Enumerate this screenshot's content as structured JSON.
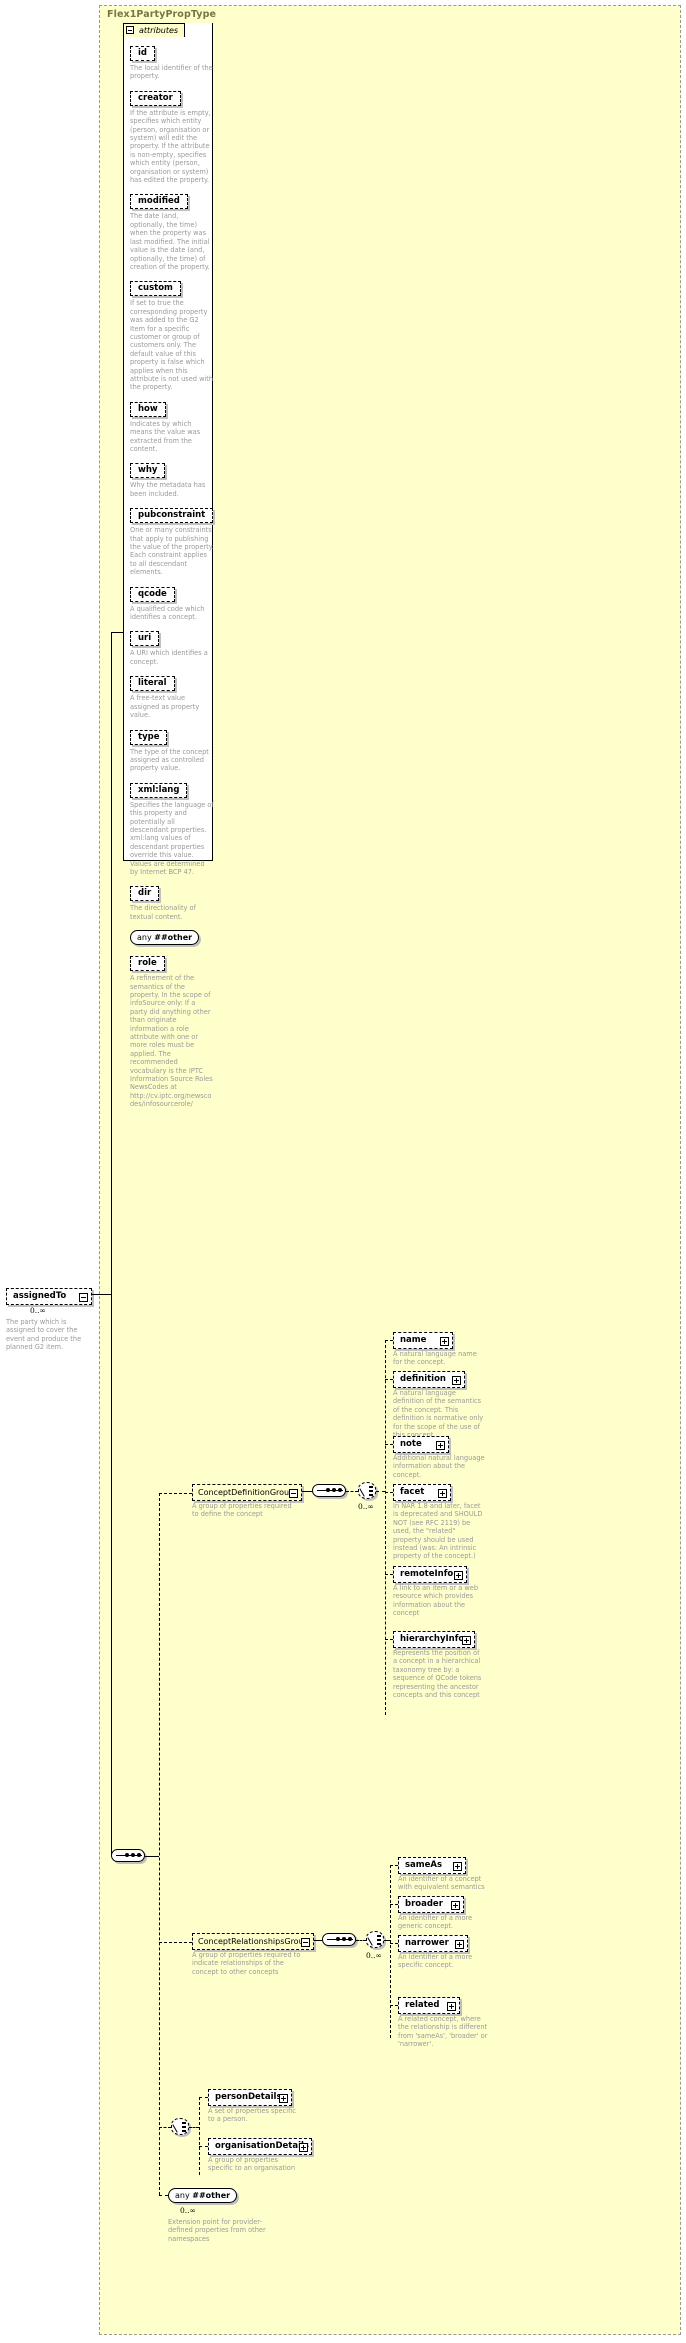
{
  "diagram": {
    "type_name": "Flex1PartyPropType",
    "attributes_label": "attributes",
    "colors": {
      "type_fill": "#ffffcc",
      "desc_text": "#9a9a9a",
      "title_text": "#777744",
      "box_fill": "#ffffff"
    }
  },
  "attributes": [
    {
      "name": "id",
      "desc": "The local identifier of the property."
    },
    {
      "name": "creator",
      "desc": "If the attribute is empty, specifies which entity (person, organisation or system) will edit the property. If the attribute is non-empty, specifies which entity (person, organisation or system) has edited the property."
    },
    {
      "name": "modified",
      "desc": "The date (and, optionally, the time) when the property was last modified. The initial value is the date (and, optionally, the time) of creation of the property."
    },
    {
      "name": "custom",
      "desc": "If set to true the corresponding property was added to the G2 Item for a specific customer or group of customers only. The default value of this property is false which applies when this attribute is not used with the property."
    },
    {
      "name": "how",
      "desc": "Indicates by which means the value was extracted from the content."
    },
    {
      "name": "why",
      "desc": "Why the metadata has been included."
    },
    {
      "name": "pubconstraint",
      "desc": "One or many constraints that apply to publishing the value of the property. Each constraint applies to all descendant elements."
    },
    {
      "name": "qcode",
      "desc": "A qualified code which identifies a concept."
    },
    {
      "name": "uri",
      "desc": "A URI which identifies a concept."
    },
    {
      "name": "literal",
      "desc": "A free-text value assigned as property value."
    },
    {
      "name": "type",
      "desc": "The type of the concept assigned as controlled property value."
    },
    {
      "name": "xml:lang",
      "desc": "Specifies the language of this property and potentially all descendant properties. xml:lang values of descendant properties override this value. Values are determined by Internet BCP 47."
    },
    {
      "name": "dir",
      "desc": "The directionality of textual content."
    },
    {
      "name": "any ##other",
      "desc": "",
      "is_any": true,
      "any_prefix": "any",
      "any_ns": "##other"
    },
    {
      "name": "role",
      "desc": "A refinement of the semantics of the property. In the scope of infoSource only: If a party did anything other than originate information a role attribute with one or more roles must be applied. The recommended vocabulary is the IPTC Information Source Roles NewsCodes at http://cv.iptc.org/newscodes/infosourcerole/"
    }
  ],
  "root_element": {
    "name": "assignedTo",
    "cardinality": "0..∞",
    "desc": "The party which is assigned to cover the event and produce the planned G2 item."
  },
  "groups": [
    {
      "name": "ConceptDefinitionGroup",
      "desc": "A group of properties required to define the concept",
      "cardinality": "0..∞",
      "members": [
        {
          "name": "name",
          "desc": "A natural language name for the concept."
        },
        {
          "name": "definition",
          "desc": "A natural language definition of the semantics of the concept. This definition is normative only for the scope of the use of this concept."
        },
        {
          "name": "note",
          "desc": "Additional natural language information about the concept."
        },
        {
          "name": "facet",
          "desc": "In NAR 1.8 and later, facet is deprecated and SHOULD NOT (see RFC 2119) be used, the \"related\" property should be used instead (was: An intrinsic property of the concept.)"
        },
        {
          "name": "remoteInfo",
          "desc": "A link to an item or a web resource which provides information about the concept"
        },
        {
          "name": "hierarchyInfo",
          "desc": "Represents the position of a concept in a hierarchical taxonomy tree by: a sequence of QCode tokens representing the ancestor concepts and this concept"
        }
      ]
    },
    {
      "name": "ConceptRelationshipsGroup",
      "desc": "A group of properties required to indicate relationships of the concept to other concepts",
      "cardinality": "0..∞",
      "members": [
        {
          "name": "sameAs",
          "desc": "An identifier of a concept with equivalent semantics"
        },
        {
          "name": "broader",
          "desc": "An identifier of a more generic concept."
        },
        {
          "name": "narrower",
          "desc": "An identifier of a more specific concept."
        },
        {
          "name": "related",
          "desc": "A related concept, where the relationship is different from 'sameAs', 'broader' or 'narrower'."
        }
      ]
    }
  ],
  "details_choice": [
    {
      "name": "personDetails",
      "desc": "A set of properties specific to a person."
    },
    {
      "name": "organisationDetails",
      "desc": "A group of properties specific to an organisation"
    }
  ],
  "extension": {
    "prefix": "any",
    "ns": "##other",
    "cardinality": "0..∞",
    "desc": "Extension point for provider-defined properties from other namespaces"
  }
}
